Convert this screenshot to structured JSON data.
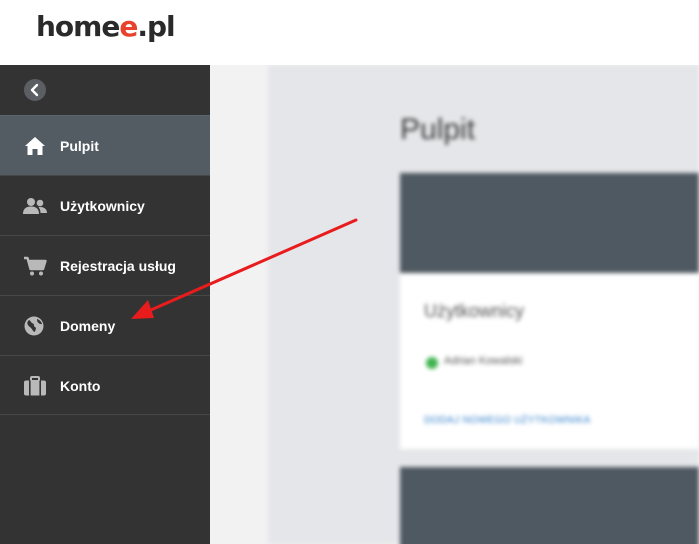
{
  "header": {
    "logo_main": "home",
    "logo_accent": "e",
    "logo_suffix": ".pl",
    "accent_color": "#e8412c"
  },
  "sidebar": {
    "collapse_icon": "chevron-left-icon",
    "items": [
      {
        "label": "Pulpit",
        "icon": "home-icon",
        "active": true
      },
      {
        "label": "Użytkownicy",
        "icon": "users-icon",
        "active": false
      },
      {
        "label": "Rejestracja usług",
        "icon": "cart-icon",
        "active": false
      },
      {
        "label": "Domeny",
        "icon": "globe-icon",
        "active": false
      },
      {
        "label": "Konto",
        "icon": "briefcase-icon",
        "active": false
      }
    ]
  },
  "main": {
    "title": "Pulpit",
    "users_card": {
      "title": "Użytkownicy",
      "user": "Adrian Kowalski",
      "link": "DODAJ NOWEGO UŻYTKOWNIKA"
    }
  },
  "annotation": {
    "arrow_color": "#e81c1c",
    "points_to": "Domeny"
  }
}
